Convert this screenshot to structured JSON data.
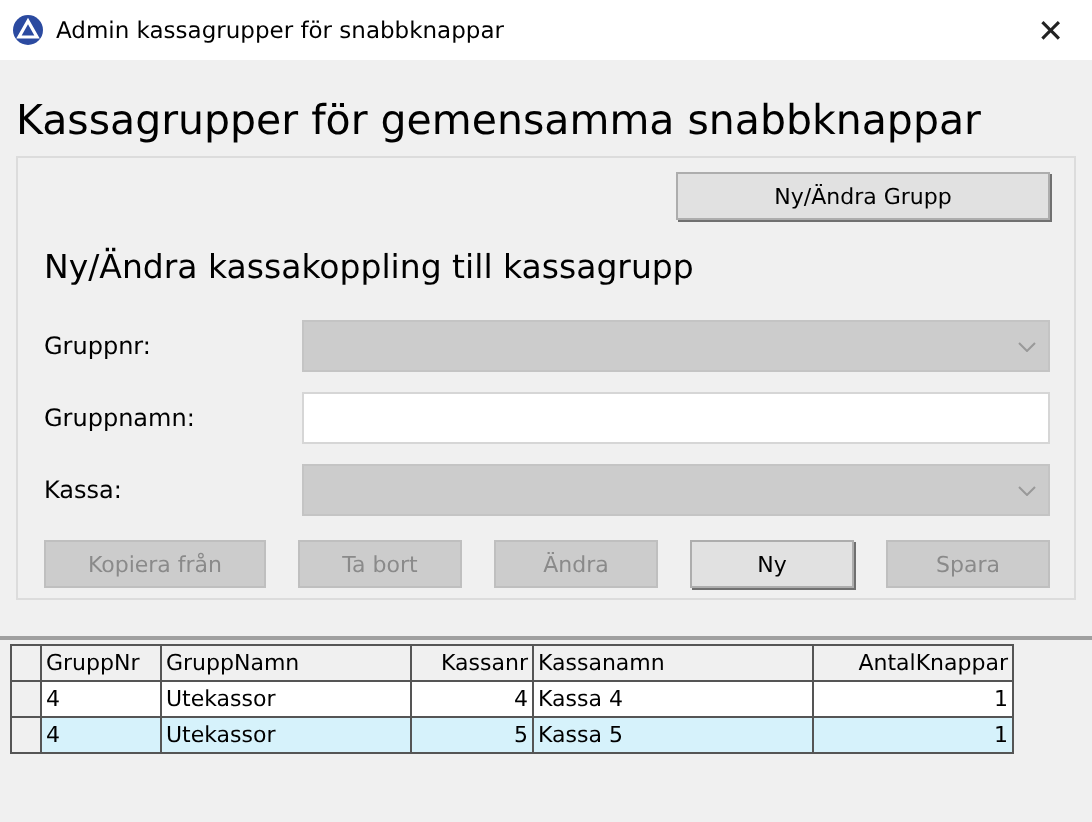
{
  "window": {
    "title": "Admin kassagrupper för snabbknappar",
    "close": "✕"
  },
  "heading": "Kassagrupper för gemensamma snabbknappar",
  "group_button": {
    "label": "Ny/Ändra Grupp",
    "disabled": false
  },
  "subheading": "Ny/Ändra kassakoppling till kassagrupp",
  "fields": [
    {
      "label": "Gruppnr:",
      "kind": "dropdown",
      "disabled": true
    },
    {
      "label": "Gruppnamn:",
      "kind": "text",
      "disabled": false
    },
    {
      "label": "Kassa:",
      "kind": "dropdown",
      "disabled": true
    }
  ],
  "buttons": [
    {
      "label": "Kopiera från",
      "disabled": true
    },
    {
      "label": "Ta bort",
      "disabled": true
    },
    {
      "label": "Ändra",
      "disabled": true
    },
    {
      "label": "Ny",
      "disabled": false
    },
    {
      "label": "Spara",
      "disabled": true
    }
  ],
  "table": {
    "columns": [
      {
        "label": "GruppNr",
        "numeric": false
      },
      {
        "label": "GruppNamn",
        "numeric": false
      },
      {
        "label": "Kassanr",
        "numeric": true
      },
      {
        "label": "Kassanamn",
        "numeric": false
      },
      {
        "label": "AntalKnappar",
        "numeric": true
      }
    ],
    "rows": [
      {
        "cells": [
          "4",
          "Utekassor",
          "4",
          "Kassa 4",
          "1"
        ],
        "selected": false
      },
      {
        "cells": [
          "4",
          "Utekassor",
          "5",
          "Kassa 5",
          "1"
        ],
        "selected": true
      }
    ]
  }
}
